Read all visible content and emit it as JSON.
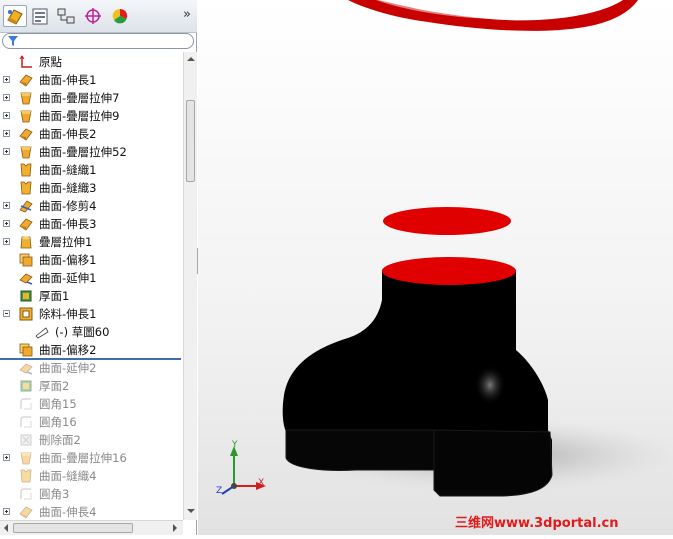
{
  "toolbar": {
    "tabs": [
      {
        "name": "featuremanager"
      },
      {
        "name": "propertymanager"
      },
      {
        "name": "configurationmanager"
      },
      {
        "name": "dimxpert"
      },
      {
        "name": "display-manager"
      }
    ],
    "more_label": "»"
  },
  "tree": {
    "items": [
      {
        "label": "原點",
        "icon": "origin-icon",
        "expander": "none",
        "state": "active"
      },
      {
        "label": "曲面-伸長1",
        "icon": "surface-extrude-icon",
        "expander": "plus",
        "state": "active"
      },
      {
        "label": "曲面-疊層拉伸7",
        "icon": "surface-loft-icon",
        "expander": "plus",
        "state": "active"
      },
      {
        "label": "曲面-疊層拉伸9",
        "icon": "surface-loft-icon",
        "expander": "plus",
        "state": "active"
      },
      {
        "label": "曲面-伸長2",
        "icon": "surface-extrude-icon",
        "expander": "plus",
        "state": "active"
      },
      {
        "label": "曲面-疊層拉伸52",
        "icon": "surface-loft-icon",
        "expander": "plus",
        "state": "active"
      },
      {
        "label": "曲面-縫織1",
        "icon": "surface-knit-icon",
        "expander": "none",
        "state": "active"
      },
      {
        "label": "曲面-縫織3",
        "icon": "surface-knit-icon",
        "expander": "none",
        "state": "active"
      },
      {
        "label": "曲面-修剪4",
        "icon": "surface-trim-icon",
        "expander": "plus",
        "state": "active"
      },
      {
        "label": "曲面-伸長3",
        "icon": "surface-extrude-icon",
        "expander": "plus",
        "state": "active"
      },
      {
        "label": "疊層拉伸1",
        "icon": "loft-icon",
        "expander": "plus",
        "state": "active"
      },
      {
        "label": "曲面-偏移1",
        "icon": "surface-offset-icon",
        "expander": "none",
        "state": "active"
      },
      {
        "label": "曲面-延伸1",
        "icon": "surface-extend-icon",
        "expander": "none",
        "state": "active"
      },
      {
        "label": "厚面1",
        "icon": "thicken-icon",
        "expander": "none",
        "state": "active"
      },
      {
        "label": "除料-伸長1",
        "icon": "cut-extrude-icon",
        "expander": "minus",
        "state": "active"
      },
      {
        "label": "(-) 草圖60",
        "icon": "sketch-icon",
        "expander": "none",
        "state": "active",
        "indent": 1
      },
      {
        "label": "曲面-偏移2",
        "icon": "surface-offset-icon",
        "expander": "none",
        "state": "active"
      },
      {
        "label": "曲面-延伸2",
        "icon": "surface-extend-icon",
        "expander": "none",
        "state": "suppressed"
      },
      {
        "label": "厚面2",
        "icon": "thicken-icon",
        "expander": "none",
        "state": "suppressed"
      },
      {
        "label": "圓角15",
        "icon": "fillet-icon",
        "expander": "none",
        "state": "suppressed"
      },
      {
        "label": "圓角16",
        "icon": "fillet-icon",
        "expander": "none",
        "state": "suppressed"
      },
      {
        "label": "刪除面2",
        "icon": "delete-face-icon",
        "expander": "none",
        "state": "suppressed"
      },
      {
        "label": "曲面-疊層拉伸16",
        "icon": "surface-loft-icon",
        "expander": "plus",
        "state": "suppressed"
      },
      {
        "label": "曲面-縫織4",
        "icon": "surface-knit-icon",
        "expander": "none",
        "state": "suppressed"
      },
      {
        "label": "圓角3",
        "icon": "fillet-icon",
        "expander": "none",
        "state": "suppressed"
      },
      {
        "label": "曲面-伸長4",
        "icon": "surface-extrude-icon",
        "expander": "plus",
        "state": "suppressed"
      }
    ]
  },
  "viewport": {
    "triad": {
      "x": "X",
      "y": "Y",
      "z": "Z"
    },
    "colors": {
      "face": "#e00000",
      "body": "#000000",
      "triad_x": "#d02020",
      "triad_y": "#2a9a2a",
      "triad_z": "#2040c0"
    }
  },
  "watermark": "三维网www.3dportal.cn"
}
